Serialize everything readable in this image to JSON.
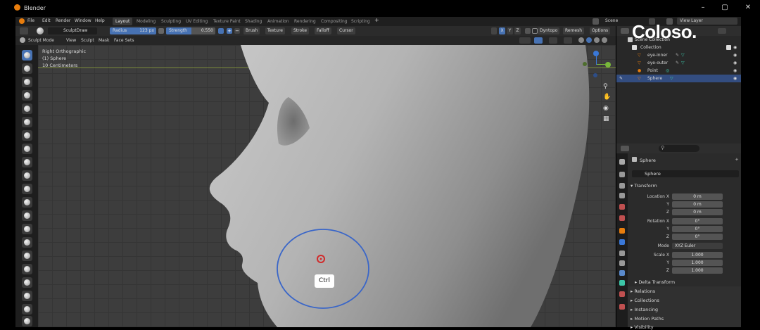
{
  "window": {
    "app_title": "Blender",
    "minimize": "–",
    "maximize": "▢",
    "close": "✕"
  },
  "menubar": {
    "menus": [
      "File",
      "Edit",
      "Render",
      "Window",
      "Help"
    ],
    "workspaces": [
      "Layout",
      "Modeling",
      "Sculpting",
      "UV Editing",
      "Texture Paint",
      "Shading",
      "Animation",
      "Rendering",
      "Compositing",
      "Scripting"
    ],
    "add_tab": "+",
    "scene_name": "Scene",
    "view_layer": "View Layer"
  },
  "tool_header": {
    "brush_name": "SculptDraw",
    "radius_label": "Radius",
    "radius_value": "123 px",
    "strength_label": "Strength",
    "strength_value": "0.550",
    "menus": [
      "Brush",
      "Texture",
      "Stroke",
      "Falloff",
      "Cursor"
    ],
    "axes": [
      "X",
      "Y",
      "Z"
    ],
    "dyntopo": "Dyntopo",
    "remesh": "Remesh",
    "options": "Options"
  },
  "mode_header": {
    "mode": "Sculpt Mode",
    "menus": [
      "View",
      "Sculpt",
      "Mask",
      "Face Sets"
    ]
  },
  "viewport": {
    "view_name": "Right Orthographic",
    "object_line": "(1) Sphere",
    "scale_line": "10 Centimeters",
    "key_hint": "Ctrl"
  },
  "outliner": {
    "rows": [
      {
        "label": "Scene Collection"
      },
      {
        "label": "Collection"
      },
      {
        "label": "eye-inner"
      },
      {
        "label": "eye-outer"
      },
      {
        "label": "Point"
      },
      {
        "label": "Sphere"
      }
    ]
  },
  "properties": {
    "object_name": "Sphere",
    "data_name": "Sphere",
    "transform_label": "Transform",
    "location": {
      "label": "Location X",
      "x": "0 m",
      "y": "0 m",
      "z": "0 m"
    },
    "rotation": {
      "label": "Rotation X",
      "x": "0°",
      "y": "0°",
      "z": "0°"
    },
    "mode": {
      "label": "Mode",
      "value": "XYZ Euler"
    },
    "scale": {
      "label": "Scale X",
      "x": "1.000",
      "y": "1.000",
      "z": "1.000"
    },
    "axis_y": "Y",
    "axis_z": "Z",
    "sections": [
      "Delta Transform",
      "Relations",
      "Collections",
      "Instancing",
      "Motion Paths",
      "Visibility"
    ]
  },
  "watermark": {
    "brand": "Coloso."
  },
  "colors": {
    "accent": "#4772b3",
    "selection": "#334d80",
    "brush_circle": "#3a66c8",
    "cursor_red": "#d12b2b"
  }
}
